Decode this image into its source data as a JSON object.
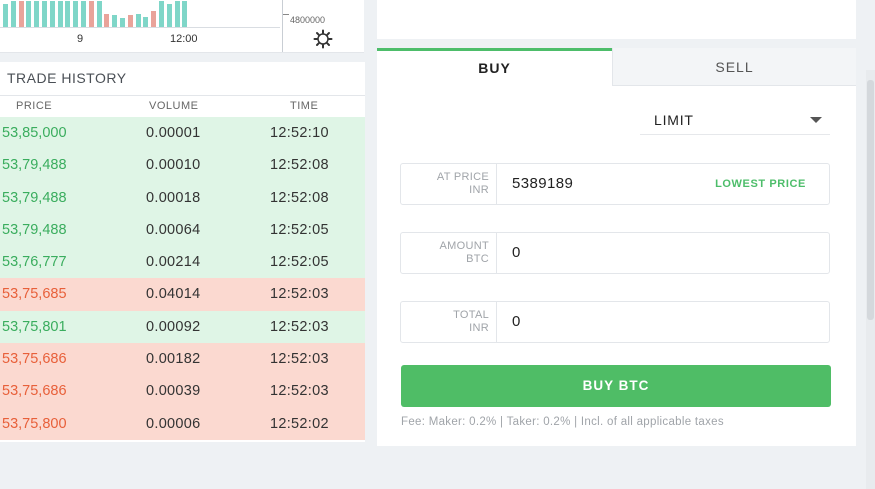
{
  "chart": {
    "x_ticks": [
      "9",
      "12:00"
    ],
    "price_label": "4800000",
    "settings_icon": "gear-icon",
    "volume_bar_colors": [
      "#e9a39a",
      "#7fd6c8"
    ],
    "volume_bars": [
      {
        "color": "#7fd6c8",
        "level": 0.9
      },
      {
        "color": "#7fd6c8",
        "level": 1.0
      },
      {
        "color": "#e9a39a",
        "level": 1.0
      },
      {
        "color": "#7fd6c8",
        "level": 1.0
      },
      {
        "color": "#7fd6c8",
        "level": 1.0
      },
      {
        "color": "#7fd6c8",
        "level": 1.0
      },
      {
        "color": "#7fd6c8",
        "level": 1.0
      },
      {
        "color": "#7fd6c8",
        "level": 1.0
      },
      {
        "color": "#7fd6c8",
        "level": 1.0
      },
      {
        "color": "#7fd6c8",
        "level": 1.0
      },
      {
        "color": "#7fd6c8",
        "level": 1.0
      },
      {
        "color": "#e9a39a",
        "level": 1.0
      },
      {
        "color": "#7fd6c8",
        "level": 1.0
      },
      {
        "color": "#e9a39a",
        "level": 0.5
      },
      {
        "color": "#7fd6c8",
        "level": 0.45
      },
      {
        "color": "#7fd6c8",
        "level": 0.35
      },
      {
        "color": "#e9a39a",
        "level": 0.45
      },
      {
        "color": "#7fd6c8",
        "level": 0.5
      },
      {
        "color": "#7fd6c8",
        "level": 0.4
      },
      {
        "color": "#e9a39a",
        "level": 0.6
      },
      {
        "color": "#7fd6c8",
        "level": 1.0
      },
      {
        "color": "#7fd6c8",
        "level": 0.9
      },
      {
        "color": "#7fd6c8",
        "level": 1.0
      },
      {
        "color": "#7fd6c8",
        "level": 1.0
      }
    ]
  },
  "trade_history": {
    "title": "TRADE HISTORY",
    "columns": [
      "PRICE",
      "VOLUME",
      "TIME"
    ],
    "rows": [
      {
        "price": "53,85,000",
        "volume": "0.00001",
        "time": "12:52:10",
        "side": "buy"
      },
      {
        "price": "53,79,488",
        "volume": "0.00010",
        "time": "12:52:08",
        "side": "buy"
      },
      {
        "price": "53,79,488",
        "volume": "0.00018",
        "time": "12:52:08",
        "side": "buy"
      },
      {
        "price": "53,79,488",
        "volume": "0.00064",
        "time": "12:52:05",
        "side": "buy"
      },
      {
        "price": "53,76,777",
        "volume": "0.00214",
        "time": "12:52:05",
        "side": "buy"
      },
      {
        "price": "53,75,685",
        "volume": "0.04014",
        "time": "12:52:03",
        "side": "sell"
      },
      {
        "price": "53,75,801",
        "volume": "0.00092",
        "time": "12:52:03",
        "side": "buy"
      },
      {
        "price": "53,75,686",
        "volume": "0.00182",
        "time": "12:52:03",
        "side": "sell"
      },
      {
        "price": "53,75,686",
        "volume": "0.00039",
        "time": "12:52:03",
        "side": "sell"
      },
      {
        "price": "53,75,800",
        "volume": "0.00006",
        "time": "12:52:02",
        "side": "sell"
      }
    ],
    "colors": {
      "buy_text": "#3aad5e",
      "sell_text": "#e8603a",
      "buy_bg": "#dff5e6",
      "sell_bg": "#fbd9d0"
    }
  },
  "order_form": {
    "tabs": {
      "buy": "BUY",
      "sell": "SELL"
    },
    "order_type": "LIMIT",
    "price": {
      "label_top": "AT PRICE",
      "label_bottom": "INR",
      "value": "5389189",
      "hint": "LOWEST PRICE"
    },
    "amount": {
      "label_top": "AMOUNT",
      "label_bottom": "BTC",
      "value": "0"
    },
    "total": {
      "label_top": "TOTAL",
      "label_bottom": "INR",
      "value": "0"
    },
    "submit_label": "BUY BTC",
    "fee_text": "Fee: Maker: 0.2% | Taker: 0.2% | Incl. of all applicable taxes",
    "accent_color": "#4fbd66"
  }
}
